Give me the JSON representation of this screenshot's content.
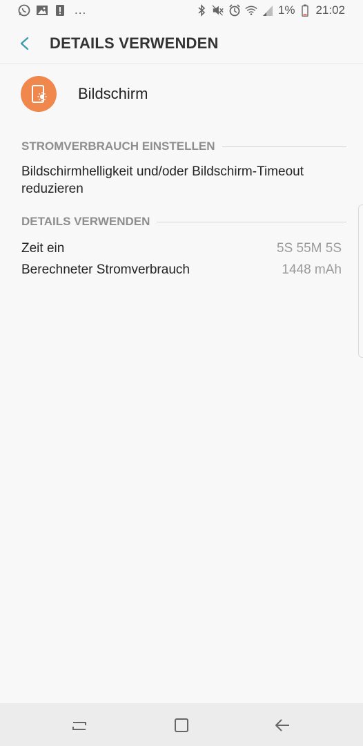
{
  "status_bar": {
    "left_icons": [
      "whatsapp-icon",
      "image-icon",
      "alert-icon"
    ],
    "overflow": "...",
    "right_icons": [
      "bluetooth-icon",
      "mute-icon",
      "alarm-icon",
      "wifi-icon",
      "signal-icon"
    ],
    "battery_percent": "1%",
    "time": "21:02"
  },
  "header": {
    "title": "DETAILS VERWENDEN"
  },
  "app": {
    "name": "Bildschirm",
    "icon": "screen-brightness-icon",
    "icon_color": "#f0884e"
  },
  "sections": {
    "power": {
      "label": "STROMVERBRAUCH EINSTELLEN",
      "tip": "Bildschirmhelligkeit und/oder Bildschirm-Timeout reduzieren"
    },
    "details": {
      "label": "DETAILS VERWENDEN",
      "rows": [
        {
          "key": "Zeit ein",
          "value": "5S 55M 5S"
        },
        {
          "key": "Berechneter Stromverbrauch",
          "value": "1448 mAh"
        }
      ]
    }
  },
  "colors": {
    "accent": "#3d9db0",
    "background": "#f8f8f8"
  }
}
